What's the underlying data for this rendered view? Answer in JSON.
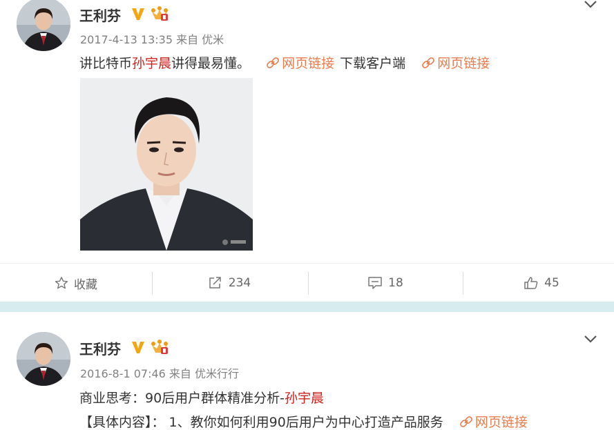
{
  "posts": [
    {
      "author": "王利芬",
      "meta": "2017-4-13 13:35 来自 优米",
      "text": {
        "pre": "讲比特币",
        "mention": "孙宇晨",
        "post": "讲得最易懂。",
        "link1": "网页链接",
        "download": "下载客户端",
        "link2": "网页链接"
      },
      "actions": {
        "favorite": "收藏",
        "repost": "234",
        "comment": "18",
        "like": "45"
      }
    },
    {
      "author": "王利芬",
      "meta": "2016-8-1 07:46 来自 优米行行",
      "line1_pre": "商业思考：90后用户群体精准分析-",
      "line1_mention": "孙宇晨",
      "line2_text": "【具体内容】： 1、教你如何利用90后用户为中心打造产品服务",
      "line2_link": "网页链接"
    }
  ],
  "icons": {
    "verified": "verified-v-icon",
    "crown": "vip-crown-icon",
    "chevron": "chevron-down-icon",
    "link": "link-icon",
    "star": "star-icon",
    "repost": "repost-icon",
    "comment": "comment-icon",
    "like": "thumbs-up-icon"
  },
  "colors": {
    "mention": "#d0211e",
    "link": "#ea7b4c",
    "verified": "#f3a612",
    "separator": "#d6ecef",
    "muted": "#808080"
  }
}
